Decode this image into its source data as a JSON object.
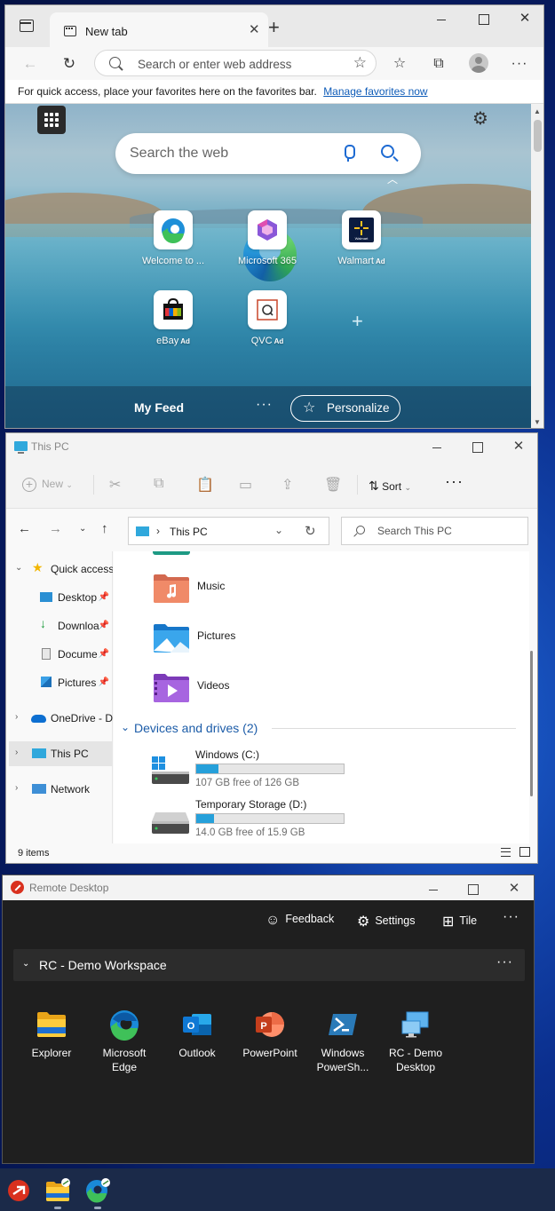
{
  "edge": {
    "tab_title": "New tab",
    "address_placeholder": "Search or enter web address",
    "favorites_prompt": "For quick access, place your favorites here on the favorites bar.",
    "manage_favorites_link": "Manage favorites now",
    "web_search_placeholder": "Search the web",
    "tiles": [
      {
        "label": "Welcome to ...",
        "ad": ""
      },
      {
        "label": "Microsoft 365",
        "ad": ""
      },
      {
        "label": "Walmart",
        "ad": "Ad"
      },
      {
        "label": "eBay",
        "ad": "Ad"
      },
      {
        "label": "QVC",
        "ad": "Ad"
      }
    ],
    "walmart_logo_text": "Walmart",
    "feed_label": "My Feed",
    "personalize_label": "Personalize"
  },
  "explorer": {
    "window_title": "This PC",
    "new_label": "New",
    "sort_label": "Sort",
    "address_location": "This PC",
    "search_placeholder": "Search This PC",
    "tree": {
      "quick_access": "Quick access",
      "desktop": "Desktop",
      "downloads": "Downloa",
      "documents": "Docume",
      "pictures": "Pictures",
      "onedrive": "OneDrive - D",
      "this_pc": "This PC",
      "network": "Network"
    },
    "folders": [
      "Music",
      "Pictures",
      "Videos"
    ],
    "devices_group_title": "Devices and drives (2)",
    "drives": [
      {
        "name": "Windows (C:)",
        "free_text": "107 GB free of 126 GB",
        "used_fraction": 0.15
      },
      {
        "name": "Temporary Storage (D:)",
        "free_text": "14.0 GB free of 15.9 GB",
        "used_fraction": 0.12
      }
    ],
    "item_count": "9 items"
  },
  "remote_desktop": {
    "window_title": "Remote Desktop",
    "feedback_label": "Feedback",
    "settings_label": "Settings",
    "tile_label": "Tile",
    "workspace_name": "RC - Demo Workspace",
    "apps": [
      {
        "name": "Explorer",
        "icon": "file-explorer-icon"
      },
      {
        "name": "Microsoft Edge",
        "icon": "edge-icon"
      },
      {
        "name": "Outlook",
        "icon": "outlook-icon"
      },
      {
        "name": "PowerPoint",
        "icon": "powerpoint-icon"
      },
      {
        "name": "Windows PowerSh...",
        "icon": "powershell-icon"
      },
      {
        "name": "RC - Demo Desktop",
        "icon": "desktop-icon"
      }
    ]
  },
  "taskbar": {
    "items": [
      "remote-desktop-icon",
      "file-explorer-remote-icon",
      "edge-remote-icon"
    ]
  }
}
